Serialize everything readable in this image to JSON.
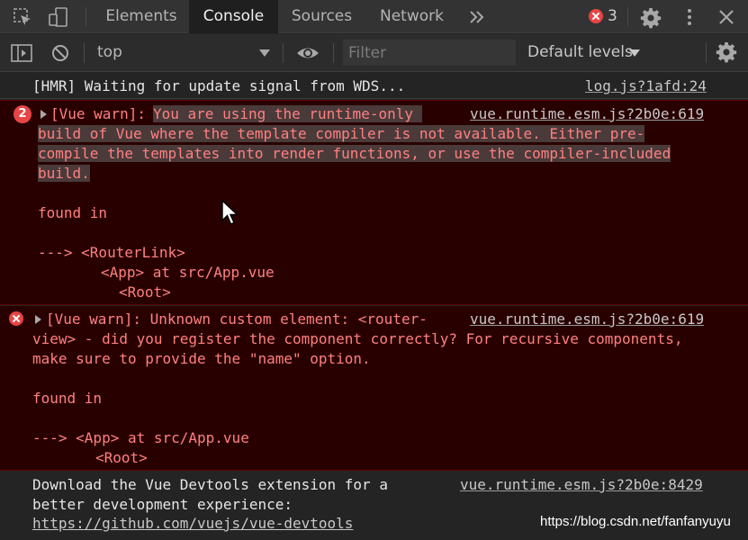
{
  "tabs": [
    {
      "label": "Elements",
      "active": false
    },
    {
      "label": "Console",
      "active": true
    },
    {
      "label": "Sources",
      "active": false
    },
    {
      "label": "Network",
      "active": false
    }
  ],
  "more_tabs_icon": "double-chevron-right-icon",
  "error_count": "3",
  "toolbar": {
    "context": "top",
    "filter_placeholder": "Filter",
    "levels": "Default levels"
  },
  "messages": {
    "log": {
      "text": "[HMR] Waiting for update signal from WDS...",
      "source": "log.js?1afd:24"
    },
    "err1": {
      "count": "2",
      "prefix": "[Vue warn]: ",
      "text_l1": "You are using the runtime-only ",
      "text_l2": "build of Vue where the template compiler is not available. Either pre-",
      "text_l3": "compile the templates into render functions, or use the compiler-included",
      "text_l4": "build.",
      "found_in": "found in",
      "trace_l1": "---> <RouterLink>",
      "trace_l2": "<App> at src/App.vue",
      "trace_l3": "<Root>",
      "source": "vue.runtime.esm.js?2b0e:619"
    },
    "err2": {
      "text_l1": "[Vue warn]: Unknown custom element: <router-",
      "text_l2": "view> - did you register the component correctly? For recursive components,",
      "text_l3": "make sure to provide the \"name\" option.",
      "found_in": "found in",
      "trace_l1": "---> <App> at src/App.vue",
      "trace_l2": "<Root>",
      "source": "vue.runtime.esm.js?2b0e:619"
    },
    "info": {
      "text_l1": "Download the Vue Devtools extension for a",
      "text_l2": "better development experience:",
      "link": "https://github.com/vuejs/vue-devtools",
      "source": "vue.runtime.esm.js?2b0e:8429"
    }
  },
  "watermark": "https://blog.csdn.net/fanfanyuyu",
  "colors": {
    "error_bg": "#290000",
    "error_text": "#ff8080",
    "error_badge": "#e84545",
    "panel_bg": "#242424",
    "toolbar_bg": "#333333"
  }
}
